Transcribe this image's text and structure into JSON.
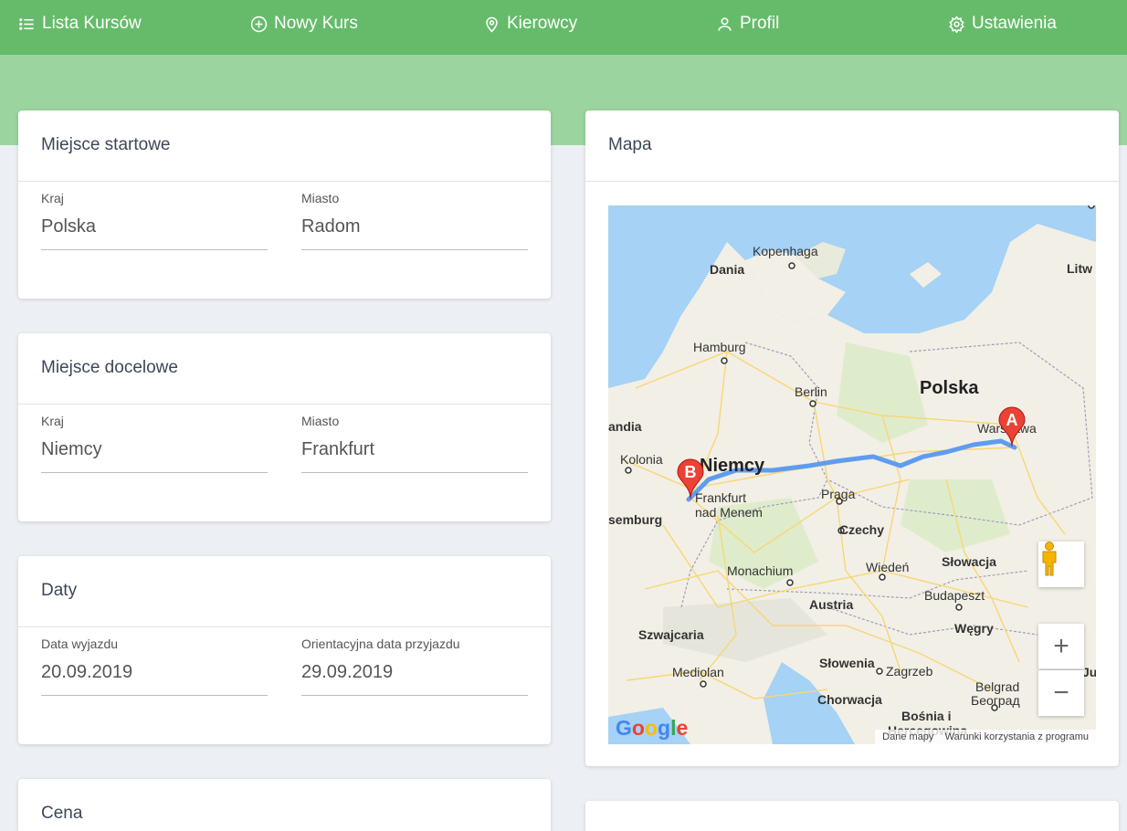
{
  "nav": {
    "items": [
      {
        "label": "Lista Kursów",
        "icon": "list-icon"
      },
      {
        "label": "Nowy Kurs",
        "icon": "plus-circle-icon"
      },
      {
        "label": "Kierowcy",
        "icon": "map-pin-icon"
      },
      {
        "label": "Profil",
        "icon": "user-icon"
      },
      {
        "label": "Ustawienia",
        "icon": "gear-icon"
      }
    ]
  },
  "start": {
    "title": "Miejsce startowe",
    "country_label": "Kraj",
    "country": "Polska",
    "city_label": "Miasto",
    "city": "Radom"
  },
  "destination": {
    "title": "Miejsce docelowe",
    "country_label": "Kraj",
    "country": "Niemcy",
    "city_label": "Miasto",
    "city": "Frankfurt"
  },
  "dates": {
    "title": "Daty",
    "departure_label": "Data wyjazdu",
    "departure": "20.09.2019",
    "arrival_label": "Orientacyjna data przyjazdu",
    "arrival": "29.09.2019"
  },
  "price": {
    "title": "Cena"
  },
  "map": {
    "title": "Mapa",
    "labels": {
      "kopenhaga": "Kopenhaga",
      "dania": "Dania",
      "litwa": "Litw",
      "hamburg": "Hamburg",
      "berlin": "Berlin",
      "polska": "Polska",
      "warszawa": "Warszawa",
      "holandia": "andia",
      "kolonia": "Kolonia",
      "niemcy": "Niemcy",
      "frankfurt1": "Frankfurt",
      "frankfurt2": "nad Menem",
      "luksemburg": "semburg",
      "praga": "Praga",
      "czechy": "Czechy",
      "monachium": "Monachium",
      "wieden": "Wiedeń",
      "slowacja": "Słowacja",
      "austria": "Austria",
      "budapeszt": "Budapeszt",
      "wegry": "Węgry",
      "szwajcaria": "Szwajcaria",
      "slowenia": "Słowenia",
      "zagrzeb": "Zagrzeb",
      "mediolan": "Mediolan",
      "chorwacja": "Chorwacja",
      "belgrad": "Belgrad",
      "belgrad_cyr": "Београд",
      "bosnia": "Bośnia i",
      "hercegowina": "Hercegowina",
      "serbia_edge": "Ju"
    },
    "marker_a": "A",
    "marker_b": "B",
    "zoom_in": "+",
    "zoom_out": "−",
    "google": "Google",
    "footer_data": "Dane mapy",
    "footer_terms": "Warunki korzystania z programu",
    "colors": {
      "water": "#a5d2f5",
      "land": "#f2efe6",
      "route": "#5f9cf0",
      "marker": "#ea4335"
    }
  }
}
